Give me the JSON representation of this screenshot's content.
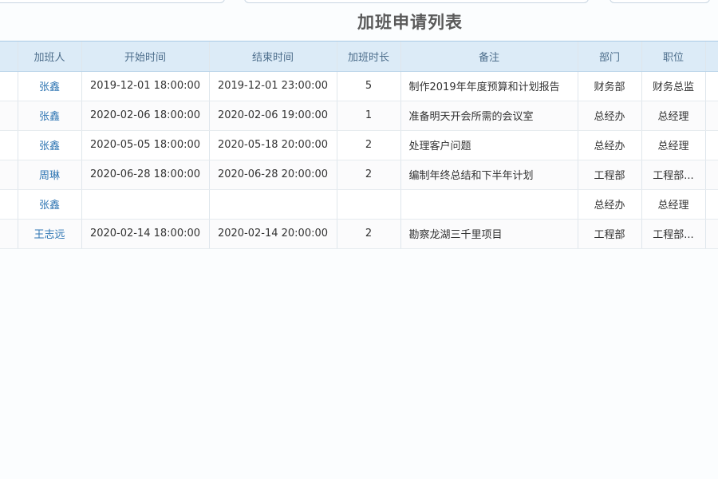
{
  "page": {
    "title": "加班申请列表"
  },
  "table": {
    "columns": [
      "加班人",
      "开始时间",
      "结束时间",
      "加班时长",
      "备注",
      "部门",
      "职位"
    ],
    "rows": [
      {
        "person": "张鑫",
        "start": "2019-12-01 18:00:00",
        "end": "2019-12-01 23:00:00",
        "hours": "5",
        "remark": "制作2019年年度预算和计划报告",
        "dept": "财务部",
        "position": "财务总监"
      },
      {
        "person": "张鑫",
        "start": "2020-02-06 18:00:00",
        "end": "2020-02-06 19:00:00",
        "hours": "1",
        "remark": "准备明天开会所需的会议室",
        "dept": "总经办",
        "position": "总经理"
      },
      {
        "person": "张鑫",
        "start": "2020-05-05 18:00:00",
        "end": "2020-05-18 20:00:00",
        "hours": "2",
        "remark": "处理客户问题",
        "dept": "总经办",
        "position": "总经理"
      },
      {
        "person": "周琳",
        "start": "2020-06-28 18:00:00",
        "end": "2020-06-28 20:00:00",
        "hours": "2",
        "remark": "编制年终总结和下半年计划",
        "dept": "工程部",
        "position": "工程部..."
      },
      {
        "person": "张鑫",
        "start": "",
        "end": "",
        "hours": "",
        "remark": "",
        "dept": "总经办",
        "position": "总经理"
      },
      {
        "person": "王志远",
        "start": "2020-02-14 18:00:00",
        "end": "2020-02-14 20:00:00",
        "hours": "2",
        "remark": "勘察龙湖三千里项目",
        "dept": "工程部",
        "position": "工程部..."
      }
    ]
  }
}
